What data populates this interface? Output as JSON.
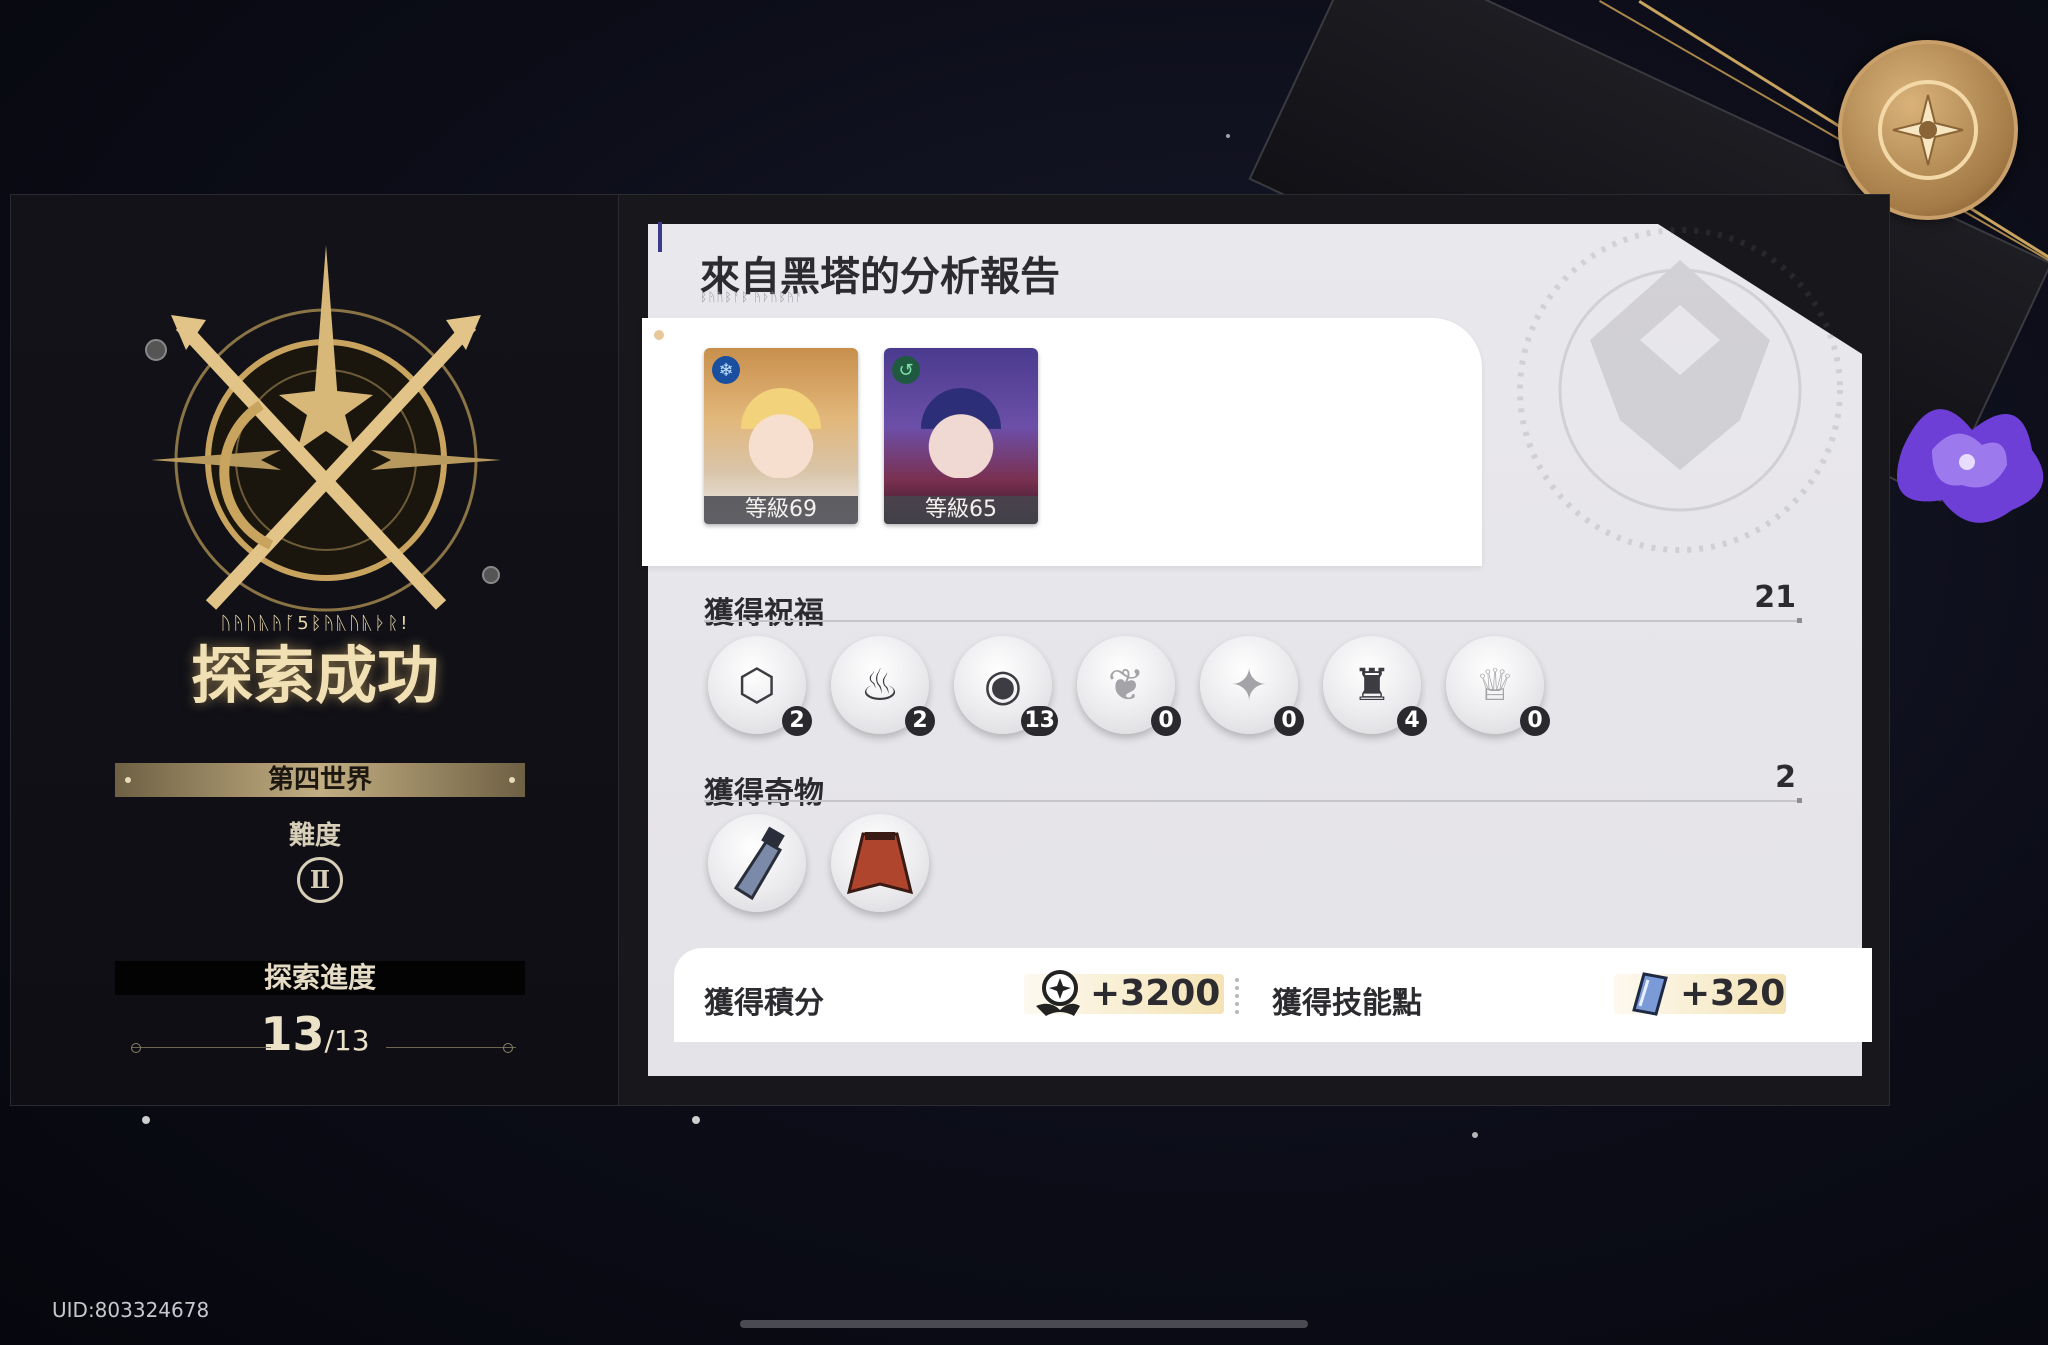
{
  "left_panel": {
    "emblem_caption": "ᚢᚤᚢᚣᚤᚪ5ᛒᚤᚣᚢᚣᚦᚱ!",
    "status_title": "探索成功",
    "world_name": "第四世界",
    "difficulty_label": "難度",
    "difficulty_value": "Ⅱ",
    "progress_label": "探索進度",
    "progress_current": "13",
    "progress_total": "/13"
  },
  "report": {
    "title": "來自黑塔的分析報告",
    "subtitle": "ᛒᚤᚢᛒᚨᛒ ᚤᚦᚢᛒᚤᚨ",
    "team": [
      {
        "level_label": "等級69",
        "element_icon": "ice-element-icon"
      },
      {
        "level_label": "等級65",
        "element_icon": "wind-element-icon"
      }
    ],
    "blessings_label": "獲得祝福",
    "blessings_count": "21",
    "blessings": [
      {
        "icon": "preservation-path-icon",
        "count": "2"
      },
      {
        "icon": "remembrance-path-icon",
        "count": "2"
      },
      {
        "icon": "nihility-path-icon",
        "count": "13"
      },
      {
        "icon": "abundance-path-icon",
        "count": "0"
      },
      {
        "icon": "hunt-path-icon",
        "count": "0"
      },
      {
        "icon": "destruction-path-icon",
        "count": "4"
      },
      {
        "icon": "elation-path-icon",
        "count": "0"
      }
    ],
    "curios_label": "獲得奇物",
    "curios_count": "2",
    "curios": [
      {
        "icon": "paint-tube-curio-icon"
      },
      {
        "icon": "cloak-curio-icon"
      }
    ],
    "rewards": {
      "points_label": "獲得積分",
      "points_value": "+3200",
      "skill_label": "獲得技能點",
      "skill_value": "+320"
    }
  },
  "footer": {
    "uid": "UID:803324678"
  },
  "colors": {
    "accent_gold": "#c9a45f",
    "panel_light": "#e9e8ec",
    "count_badge": "#2a2a2e"
  }
}
